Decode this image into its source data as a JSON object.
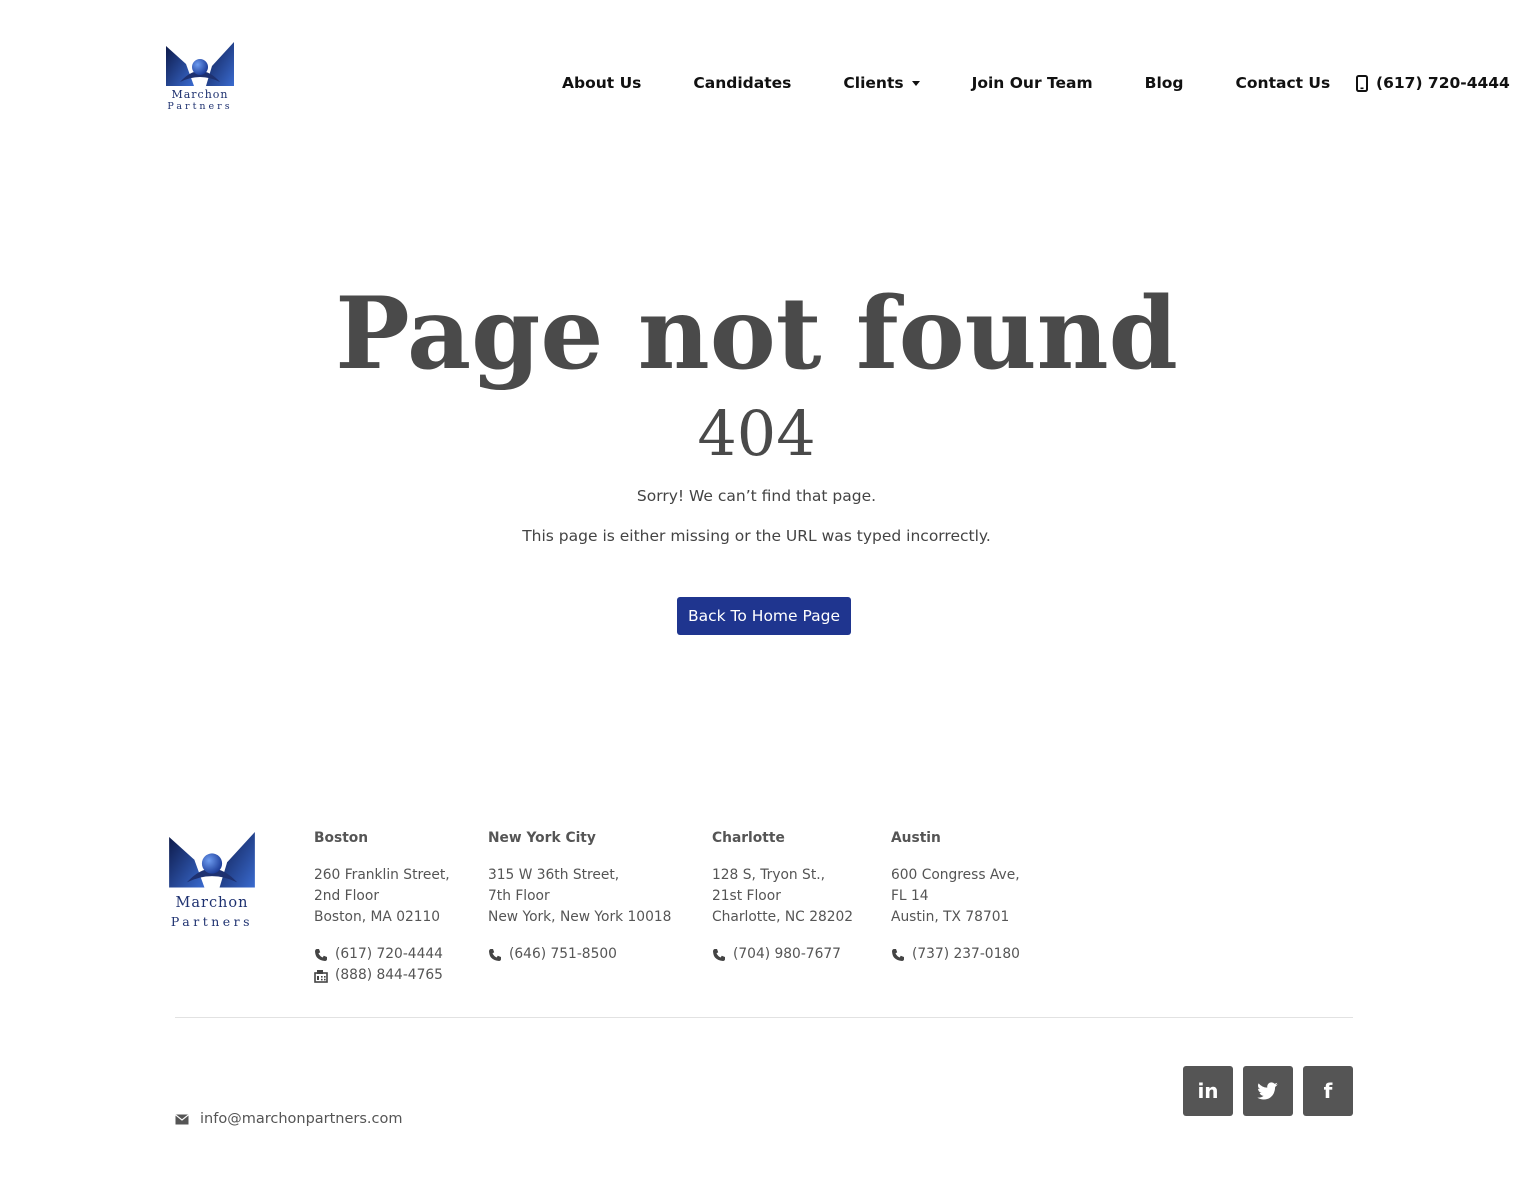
{
  "header": {
    "logo": {
      "word1": "Marchon",
      "word2": "Partners"
    },
    "nav": [
      {
        "label": "About Us"
      },
      {
        "label": "Candidates"
      },
      {
        "label": "Clients",
        "dropdown": true
      },
      {
        "label": "Join Our Team"
      },
      {
        "label": "Blog"
      },
      {
        "label": "Contact Us"
      }
    ],
    "phone": {
      "icon": "mobile-phone-icon",
      "label": "(617) 720-4444"
    }
  },
  "main": {
    "title": "Page not found",
    "code": "404",
    "message1": "Sorry! We can’t find that page.",
    "message2": "This page is either missing or the URL was typed incorrectly.",
    "button": "Back To Home Page"
  },
  "footer": {
    "logo": {
      "word1": "Marchon",
      "word2": "Partners"
    },
    "offices": [
      {
        "city": "Boston",
        "address": [
          "260 Franklin Street,",
          "2nd Floor",
          "Boston, MA 02110"
        ],
        "phone": "(617) 720-4444",
        "fax": "(888) 844-4765"
      },
      {
        "city": "New York City",
        "address": [
          "315 W 36th Street,",
          "7th Floor",
          "New York, New York 10018"
        ],
        "phone": "(646) 751-8500"
      },
      {
        "city": "Charlotte",
        "address": [
          "128 S, Tryon St.,",
          "21st Floor",
          "Charlotte, NC 28202"
        ],
        "phone": "(704) 980-7677"
      },
      {
        "city": "Austin",
        "address": [
          "600 Congress Ave,",
          "FL 14",
          "Austin, TX 78701"
        ],
        "phone": "(737) 237-0180"
      }
    ],
    "email": "info@marchonpartners.com",
    "social": [
      {
        "icon": "linkedin-icon",
        "glyph": "in"
      },
      {
        "icon": "twitter-icon"
      },
      {
        "icon": "facebook-icon",
        "glyph": "f"
      }
    ],
    "colors": {
      "accent": "#1f358f",
      "text": "#444444",
      "social_bg": "#555555"
    }
  }
}
